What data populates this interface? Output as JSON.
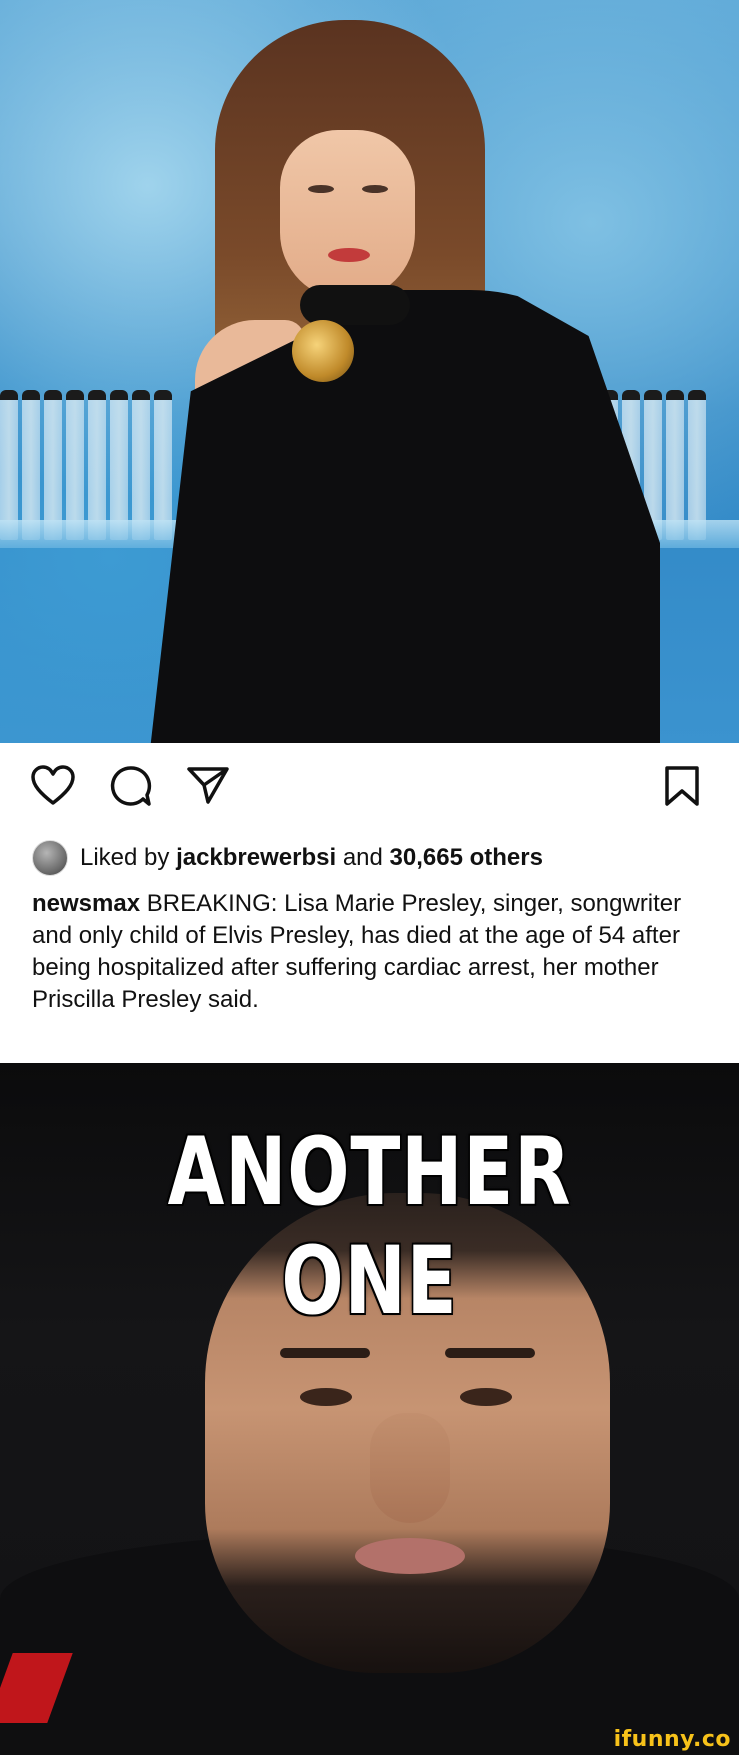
{
  "post": {
    "actions": {
      "like_icon": "heart-icon",
      "comment_icon": "comment-icon",
      "share_icon": "send-icon",
      "save_icon": "bookmark-icon"
    },
    "likes": {
      "prefix": "Liked by",
      "user": "jackbrewerbsi",
      "middle": "and",
      "count": "30,665 others"
    },
    "caption": {
      "username": "newsmax",
      "text": "BREAKING: Lisa Marie Presley, singer, songwriter and only child of Elvis Presley, has died at the age of 54 after being hospitalized after suffering cardiac arrest, her mother Priscilla Presley said."
    }
  },
  "meme": {
    "text": "ANOTHER ONE"
  },
  "watermark": {
    "text": "ifunny.co",
    "color": "#f7c21a"
  }
}
